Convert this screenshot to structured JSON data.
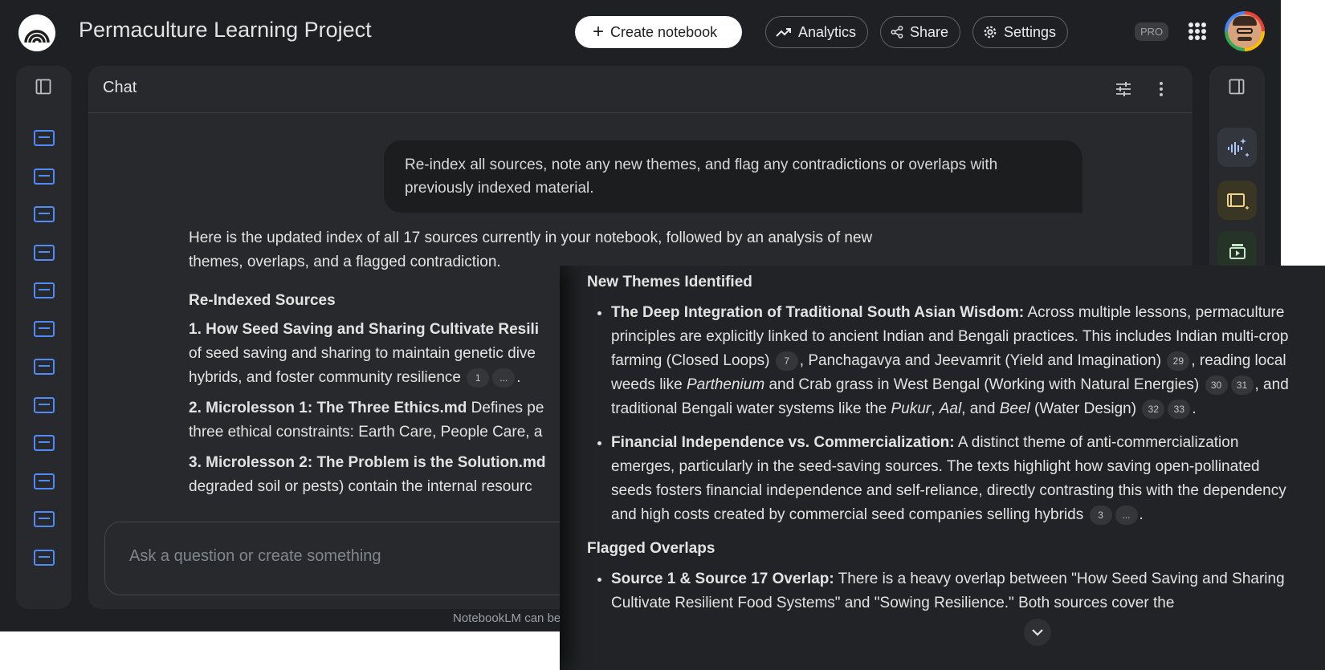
{
  "header": {
    "title": "Permaculture Learning Project",
    "create_notebook": "Create notebook",
    "analytics": "Analytics",
    "share": "Share",
    "settings": "Settings",
    "pro_badge": "PRO"
  },
  "chat": {
    "title": "Chat",
    "user_message": "Re-index all sources, note any new themes, and flag any contradictions or overlaps with previously indexed material.",
    "response_intro": "Here is the updated index of all 17 sources currently in your notebook, followed by an analysis of new themes, overlaps, and a flagged contradiction.",
    "reindexed_heading": "Re-Indexed Sources",
    "sources": [
      {
        "title": "1. How Seed Saving and Sharing Cultivate Resili",
        "text": "of seed saving and sharing to maintain genetic dive",
        "text2": "hybrids, and foster community resilience",
        "cite1": "1",
        "cite2": "..."
      },
      {
        "title": "2. Microlesson 1: The Three Ethics.md",
        "text_inline": " Defines pe",
        "text2": "three ethical constraints: Earth Care, People Care, a"
      },
      {
        "title": "3. Microlesson 2: The Problem is the Solution.md",
        "text2": "degraded soil or pests) contain the internal resourc"
      }
    ],
    "input_placeholder": "Ask a question or create something",
    "footer_note": "NotebookLM can be"
  },
  "overlay": {
    "themes_heading": "New Themes Identified",
    "theme1_title": "The Deep Integration of Traditional South Asian Wisdom:",
    "theme1_a": " Across multiple lessons, permaculture principles are explicitly linked to ancient Indian and Bengali practices. This includes Indian multi-crop farming (Closed Loops) ",
    "theme1_c7": "7",
    "theme1_b": ", Panchagavya and Jeevamrit (Yield and Imagination) ",
    "theme1_c29": "29",
    "theme1_c": ", reading local weeds like ",
    "theme1_parthenium": "Parthenium",
    "theme1_d": " and Crab grass in West Bengal (Working with Natural Energies) ",
    "theme1_c30": "30",
    "theme1_c31": "31",
    "theme1_e": ", and traditional Bengali water systems like the ",
    "theme1_pukur": "Pukur",
    "theme1_aal": "Aal",
    "theme1_and": ", and ",
    "theme1_beel": "Beel",
    "theme1_f": " (Water Design) ",
    "theme1_c32": "32",
    "theme1_c33": "33",
    "theme2_title": "Financial Independence vs. Commercialization:",
    "theme2_a": " A distinct theme of anti-commercialization emerges, particularly in the seed-saving sources. The texts highlight how saving open-pollinated seeds fosters financial independence and self-reliance, directly contrasting this with the dependency and high costs created by commercial seed companies selling hybrids ",
    "theme2_c3": "3",
    "theme2_cmore": "...",
    "overlaps_heading": "Flagged Overlaps",
    "overlap1_title": "Source 1 & Source 17 Overlap:",
    "overlap1_a": " There is a heavy overlap between \"How Seed Saving and Sharing Cultivate Resilient Food Systems\" and \"Sowing Resilience.\" Both sources cover the"
  },
  "colors": {
    "background": "#1f2023",
    "panel": "#28292c",
    "source_icon": "#4f8cf7"
  }
}
